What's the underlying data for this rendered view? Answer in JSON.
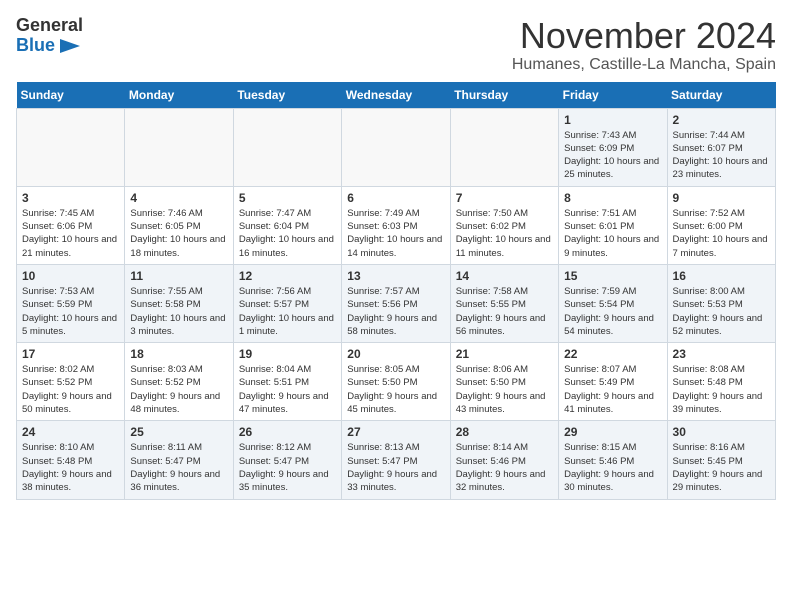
{
  "logo": {
    "line1": "General",
    "line2": "Blue"
  },
  "title": "November 2024",
  "location": "Humanes, Castille-La Mancha, Spain",
  "days_of_week": [
    "Sunday",
    "Monday",
    "Tuesday",
    "Wednesday",
    "Thursday",
    "Friday",
    "Saturday"
  ],
  "weeks": [
    [
      {
        "day": "",
        "info": ""
      },
      {
        "day": "",
        "info": ""
      },
      {
        "day": "",
        "info": ""
      },
      {
        "day": "",
        "info": ""
      },
      {
        "day": "",
        "info": ""
      },
      {
        "day": "1",
        "info": "Sunrise: 7:43 AM\nSunset: 6:09 PM\nDaylight: 10 hours and 25 minutes."
      },
      {
        "day": "2",
        "info": "Sunrise: 7:44 AM\nSunset: 6:07 PM\nDaylight: 10 hours and 23 minutes."
      }
    ],
    [
      {
        "day": "3",
        "info": "Sunrise: 7:45 AM\nSunset: 6:06 PM\nDaylight: 10 hours and 21 minutes."
      },
      {
        "day": "4",
        "info": "Sunrise: 7:46 AM\nSunset: 6:05 PM\nDaylight: 10 hours and 18 minutes."
      },
      {
        "day": "5",
        "info": "Sunrise: 7:47 AM\nSunset: 6:04 PM\nDaylight: 10 hours and 16 minutes."
      },
      {
        "day": "6",
        "info": "Sunrise: 7:49 AM\nSunset: 6:03 PM\nDaylight: 10 hours and 14 minutes."
      },
      {
        "day": "7",
        "info": "Sunrise: 7:50 AM\nSunset: 6:02 PM\nDaylight: 10 hours and 11 minutes."
      },
      {
        "day": "8",
        "info": "Sunrise: 7:51 AM\nSunset: 6:01 PM\nDaylight: 10 hours and 9 minutes."
      },
      {
        "day": "9",
        "info": "Sunrise: 7:52 AM\nSunset: 6:00 PM\nDaylight: 10 hours and 7 minutes."
      }
    ],
    [
      {
        "day": "10",
        "info": "Sunrise: 7:53 AM\nSunset: 5:59 PM\nDaylight: 10 hours and 5 minutes."
      },
      {
        "day": "11",
        "info": "Sunrise: 7:55 AM\nSunset: 5:58 PM\nDaylight: 10 hours and 3 minutes."
      },
      {
        "day": "12",
        "info": "Sunrise: 7:56 AM\nSunset: 5:57 PM\nDaylight: 10 hours and 1 minute."
      },
      {
        "day": "13",
        "info": "Sunrise: 7:57 AM\nSunset: 5:56 PM\nDaylight: 9 hours and 58 minutes."
      },
      {
        "day": "14",
        "info": "Sunrise: 7:58 AM\nSunset: 5:55 PM\nDaylight: 9 hours and 56 minutes."
      },
      {
        "day": "15",
        "info": "Sunrise: 7:59 AM\nSunset: 5:54 PM\nDaylight: 9 hours and 54 minutes."
      },
      {
        "day": "16",
        "info": "Sunrise: 8:00 AM\nSunset: 5:53 PM\nDaylight: 9 hours and 52 minutes."
      }
    ],
    [
      {
        "day": "17",
        "info": "Sunrise: 8:02 AM\nSunset: 5:52 PM\nDaylight: 9 hours and 50 minutes."
      },
      {
        "day": "18",
        "info": "Sunrise: 8:03 AM\nSunset: 5:52 PM\nDaylight: 9 hours and 48 minutes."
      },
      {
        "day": "19",
        "info": "Sunrise: 8:04 AM\nSunset: 5:51 PM\nDaylight: 9 hours and 47 minutes."
      },
      {
        "day": "20",
        "info": "Sunrise: 8:05 AM\nSunset: 5:50 PM\nDaylight: 9 hours and 45 minutes."
      },
      {
        "day": "21",
        "info": "Sunrise: 8:06 AM\nSunset: 5:50 PM\nDaylight: 9 hours and 43 minutes."
      },
      {
        "day": "22",
        "info": "Sunrise: 8:07 AM\nSunset: 5:49 PM\nDaylight: 9 hours and 41 minutes."
      },
      {
        "day": "23",
        "info": "Sunrise: 8:08 AM\nSunset: 5:48 PM\nDaylight: 9 hours and 39 minutes."
      }
    ],
    [
      {
        "day": "24",
        "info": "Sunrise: 8:10 AM\nSunset: 5:48 PM\nDaylight: 9 hours and 38 minutes."
      },
      {
        "day": "25",
        "info": "Sunrise: 8:11 AM\nSunset: 5:47 PM\nDaylight: 9 hours and 36 minutes."
      },
      {
        "day": "26",
        "info": "Sunrise: 8:12 AM\nSunset: 5:47 PM\nDaylight: 9 hours and 35 minutes."
      },
      {
        "day": "27",
        "info": "Sunrise: 8:13 AM\nSunset: 5:47 PM\nDaylight: 9 hours and 33 minutes."
      },
      {
        "day": "28",
        "info": "Sunrise: 8:14 AM\nSunset: 5:46 PM\nDaylight: 9 hours and 32 minutes."
      },
      {
        "day": "29",
        "info": "Sunrise: 8:15 AM\nSunset: 5:46 PM\nDaylight: 9 hours and 30 minutes."
      },
      {
        "day": "30",
        "info": "Sunrise: 8:16 AM\nSunset: 5:45 PM\nDaylight: 9 hours and 29 minutes."
      }
    ]
  ]
}
